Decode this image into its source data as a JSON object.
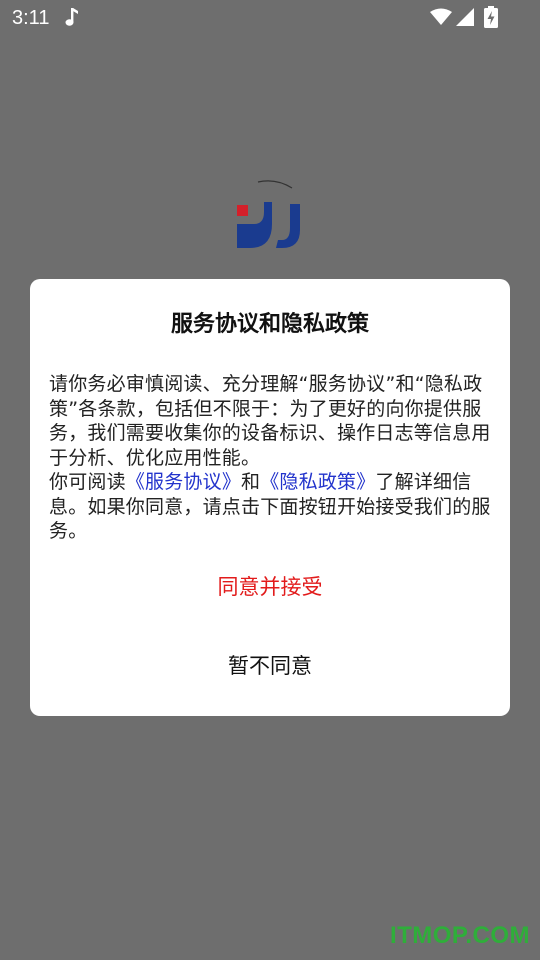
{
  "status_bar": {
    "time": "3:11",
    "icons": [
      "music-note-icon",
      "wifi-icon",
      "cell-signal-icon",
      "battery-charging-icon"
    ]
  },
  "colors": {
    "overlay": "#6e6e6e",
    "dialog_bg": "#ffffff",
    "link": "#2233cc",
    "accept": "#e21b1b",
    "logo_blue": "#1a3b8f",
    "logo_red": "#d4202a",
    "watermark": "#2fae3a"
  },
  "dialog": {
    "title": "服务协议和隐私政策",
    "body_intro": "请你务必审慎阅读、充分理解“服务协议”和“隐私政策”各条款，包括但不限于：为了更好的向你提供服务，我们需要收集你的设备标识、操作日志等信息用于分析、优化应用性能。",
    "body_read_prefix": "你可阅读",
    "service_link": "《服务协议》",
    "and_text": "和",
    "privacy_link": "《隐私政策》",
    "body_outro": "了解详细信息。如果你同意，请点击下面按钮开始接受我们的服务。",
    "accept_label": "同意并接受",
    "decline_label": "暂不同意"
  },
  "watermark": "ITMOP.COM"
}
